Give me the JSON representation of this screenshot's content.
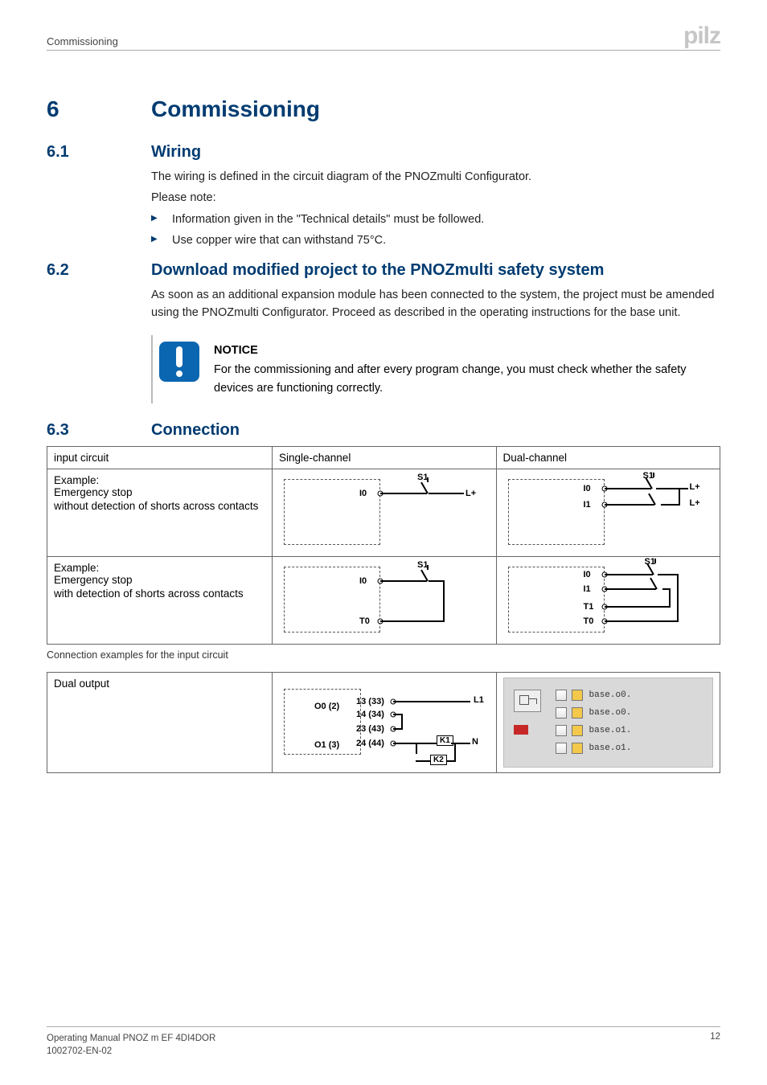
{
  "runningHead": "Commissioning",
  "logo": "pilz",
  "section": {
    "num": "6",
    "title": "Commissioning"
  },
  "s1": {
    "num": "6.1",
    "title": "Wiring",
    "p1": "The wiring is defined in the circuit diagram of the PNOZmulti Configurator.",
    "p2": "Please note:",
    "b1": "Information given in the \"Technical details\" must be followed.",
    "b2": "Use copper wire that can withstand 75°C."
  },
  "s2": {
    "num": "6.2",
    "title": "Download modified project to the PNOZmulti safety system",
    "p1": "As soon as an additional expansion module has been connected to the system, the project must be amended using the PNOZmulti Configurator. Proceed as described in the operating instructions for the base unit."
  },
  "notice": {
    "caption": "NOTICE",
    "text": "For the commissioning and after every program change, you must check whether the safety devices are functioning correctly."
  },
  "s3": {
    "num": "6.3",
    "title": "Connection"
  },
  "table1": {
    "h1": "input circuit",
    "h2": "Single-channel",
    "h3": "Dual-channel",
    "r1": {
      "c1a": "Example:",
      "c1b": "Emergency stop",
      "c1c": "without detection of shorts across contacts"
    },
    "r2": {
      "c1a": "Example:",
      "c1b": "Emergency stop",
      "c1c": "with detection of shorts across contacts"
    }
  },
  "diag": {
    "S1": "S1",
    "I0": "I0",
    "I1": "I1",
    "T0": "T0",
    "T1": "T1",
    "Lp": "L+"
  },
  "caption1": "Connection examples for the input circuit",
  "table2": {
    "r1c1": "Dual output",
    "out": {
      "O0": "O0 (2)",
      "O1": "O1 (3)",
      "t13": "13 (33)",
      "t14": "14 (34)",
      "t23": "23 (43)",
      "t24": "24 (44)",
      "L1": "L1",
      "N": "N",
      "K1": "K1",
      "K2": "K2"
    },
    "cfg": {
      "a": "base.o0.",
      "b": "base.o0.",
      "c": "base.o1.",
      "d": "base.o1."
    }
  },
  "footer": {
    "l1": "Operating Manual PNOZ m EF 4DI4DOR",
    "l2": "1002702-EN-02",
    "page": "12"
  }
}
